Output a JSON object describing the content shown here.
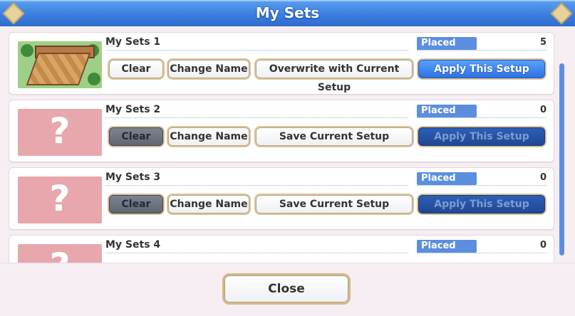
{
  "dialog": {
    "title": "My Sets",
    "close_label": "Close"
  },
  "sets": [
    {
      "name": "My Sets 1",
      "placed_label": "Placed",
      "placed_count": "5",
      "clear_label": "Clear",
      "change_name_label": "Change Name",
      "save_label": "Overwrite with Current Setup",
      "apply_label": "Apply This Setup",
      "has_preview": true
    },
    {
      "name": "My Sets 2",
      "placed_label": "Placed",
      "placed_count": "0",
      "clear_label": "Clear",
      "change_name_label": "Change Name",
      "save_label": "Save Current Setup",
      "apply_label": "Apply This Setup",
      "has_preview": false
    },
    {
      "name": "My Sets 3",
      "placed_label": "Placed",
      "placed_count": "0",
      "clear_label": "Clear",
      "change_name_label": "Change Name",
      "save_label": "Save Current Setup",
      "apply_label": "Apply This Setup",
      "has_preview": false
    },
    {
      "name": "My Sets 4",
      "placed_label": "Placed",
      "placed_count": "0",
      "has_preview": false
    }
  ],
  "empty_preview_glyph": "?"
}
